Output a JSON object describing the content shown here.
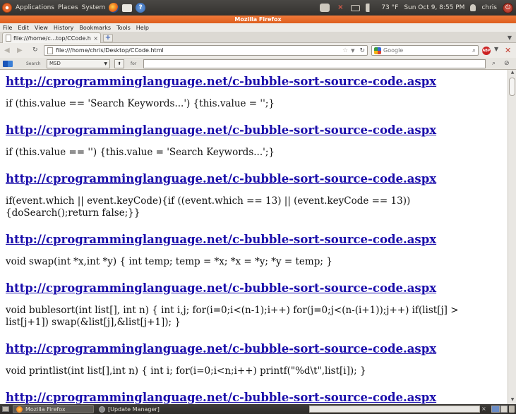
{
  "top_panel": {
    "menus": [
      "Applications",
      "Places",
      "System"
    ],
    "launchers": [
      "firefox-icon",
      "mail-icon",
      "help-icon"
    ],
    "help_glyph": "?",
    "weather": "73 °F",
    "clock": "Sun Oct  9,  8:55 PM",
    "user": "chris"
  },
  "window": {
    "title": "Mozilla Firefox"
  },
  "menubar": {
    "items": [
      "File",
      "Edit",
      "View",
      "History",
      "Bookmarks",
      "Tools",
      "Help"
    ]
  },
  "tabs": [
    {
      "title": "file:///home/c...top/CCode.html",
      "close": "×"
    }
  ],
  "toolbar": {
    "url": "file:///home/chris/Desktop/CCode.html",
    "search_placeholder": "Google",
    "abp_label": "ABP"
  },
  "search_toolbar": {
    "search_label": "Search",
    "source": "MSD",
    "for_label": "for",
    "query": ""
  },
  "content": {
    "blocks": [
      {
        "type": "link",
        "text": "http://cprogramminglanguage.net/c-bubble-sort-source-code.aspx"
      },
      {
        "type": "code",
        "text": "if (this.value == 'Search Keywords...') {this.value = '';}"
      },
      {
        "type": "link",
        "text": "http://cprogramminglanguage.net/c-bubble-sort-source-code.aspx"
      },
      {
        "type": "code",
        "text": "if (this.value == '') {this.value = 'Search Keywords...';}"
      },
      {
        "type": "link",
        "text": "http://cprogramminglanguage.net/c-bubble-sort-source-code.aspx"
      },
      {
        "type": "code",
        "text": "if(event.which || event.keyCode){if ((event.which == 13) || (event.keyCode == 13)) {doSearch();return false;}}"
      },
      {
        "type": "link",
        "text": "http://cprogramminglanguage.net/c-bubble-sort-source-code.aspx"
      },
      {
        "type": "code",
        "text": "void swap(int *x,int *y) { int temp; temp = *x; *x = *y; *y = temp; }"
      },
      {
        "type": "link",
        "text": "http://cprogramminglanguage.net/c-bubble-sort-source-code.aspx"
      },
      {
        "type": "code",
        "text": "void bublesort(int list[], int n) { int i,j; for(i=0;i<(n-1);i++) for(j=0;j<(n-(i+1));j++) if(list[j] > list[j+1]) swap(&list[j],&list[j+1]); }"
      },
      {
        "type": "link",
        "text": "http://cprogramminglanguage.net/c-bubble-sort-source-code.aspx"
      },
      {
        "type": "code",
        "text": "void printlist(int list[],int n) { int i; for(i=0;i<n;i++) printf(\"%d\\t\",list[i]); }"
      },
      {
        "type": "link",
        "text": "http://cprogramminglanguage.net/c-bubble-sort-source-code.aspx"
      }
    ]
  },
  "taskbar": {
    "tasks": [
      "Mozilla Firefox",
      "[Update Manager]"
    ]
  }
}
